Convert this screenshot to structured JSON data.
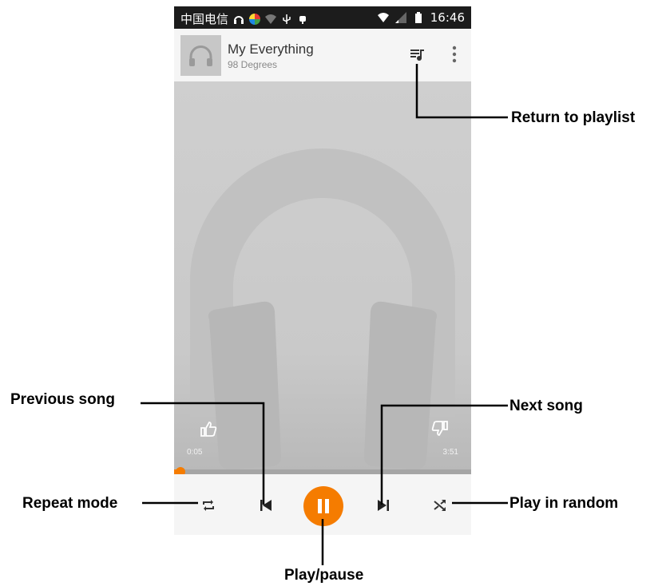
{
  "status_bar": {
    "carrier": "中国电信",
    "clock": "16:46"
  },
  "now_playing": {
    "title": "My Everything",
    "artist": "98 Degrees"
  },
  "progress": {
    "elapsed": "0:05",
    "duration": "3:51",
    "fraction": 0.022
  },
  "colors": {
    "accent": "#f57c00",
    "status_bar_bg": "#1c1c1c",
    "album_art_bg": "#cccccc"
  },
  "icons": {
    "queue": "playlist-icon",
    "menu": "more-vert-icon",
    "like": "thumb-up-icon",
    "dislike": "thumb-down-icon",
    "repeat": "repeat-icon",
    "previous": "skip-previous-icon",
    "play_pause": "pause-icon",
    "next": "skip-next-icon",
    "shuffle": "shuffle-icon"
  },
  "callouts": {
    "return_to_playlist": "Return to playlist",
    "previous_song": "Previous song",
    "next_song": "Next song",
    "repeat_mode": "Repeat mode",
    "play_in_random": "Play in random",
    "play_pause": "Play/pause"
  }
}
